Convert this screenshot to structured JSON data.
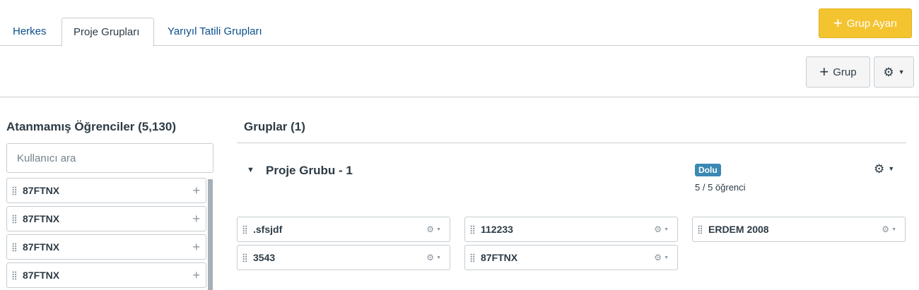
{
  "tabs": [
    {
      "label": "Herkes"
    },
    {
      "label": "Proje Grupları"
    },
    {
      "label": "Yarıyıl Tatili Grupları"
    }
  ],
  "group_set_button": {
    "icon": "plus",
    "label": "Grup Ayarı"
  },
  "toolbar": {
    "add_group_label": "Grup",
    "settings_icon": "gear"
  },
  "unassigned": {
    "title": "Atanmamış Öğrenciler (5,130)",
    "search_placeholder": "Kullanıcı ara",
    "search_value": "",
    "students": [
      {
        "name": "87FTNX"
      },
      {
        "name": "87FTNX"
      },
      {
        "name": "87FTNX"
      },
      {
        "name": "87FTNX"
      }
    ]
  },
  "groups": {
    "title": "Gruplar (1)",
    "items": [
      {
        "name": "Proje Grubu - 1",
        "status_badge": "Dolu",
        "member_count": "5 / 5 öğrenci",
        "members": [
          {
            "name": ".sfsjdf"
          },
          {
            "name": "112233"
          },
          {
            "name": "ERDEM 2008"
          },
          {
            "name": "3543"
          },
          {
            "name": "87FTNX"
          }
        ]
      }
    ]
  },
  "colors": {
    "accent_yellow": "#f4c430",
    "badge_blue": "#3b88b4",
    "link_blue": "#0b4f8a"
  }
}
